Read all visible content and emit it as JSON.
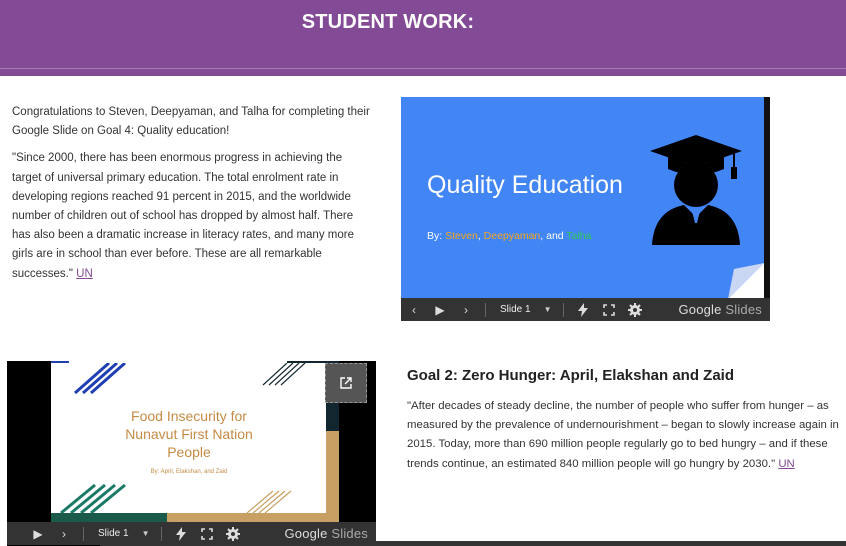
{
  "header": {
    "title": "STUDENT WORK:"
  },
  "intro": {
    "congrats": "Congratulations to Steven, Deepyaman, and Talha for completing their Google Slide on Goal 4: Quality education!",
    "quote": "\"Since 2000, there has been enormous progress in achieving the target of universal primary education. The total enrolment rate in developing regions reached 91 percent in 2015, and the worldwide number of children out of school has dropped by almost half. There has also been a dramatic increase in literacy rates, and many more girls are in school than ever before. These are all remarkable successes.\"",
    "link": "UN"
  },
  "slide1": {
    "title": "Quality Education",
    "by_prefix": "By: ",
    "author1": "Steven",
    "sep1": ", ",
    "author2": "Deepyaman",
    "sep2": ", and ",
    "author3": "Talha"
  },
  "player": {
    "prev": "‹",
    "play": "▶",
    "next": "›",
    "slide_label": "Slide 1",
    "logo_bold": "Google",
    "logo_light": " Slides"
  },
  "slide2": {
    "title_line1": "Food Insecurity for",
    "title_line2": "Nunavut First Nation",
    "title_line3": "People",
    "by": "By: April, Elakshan, and Zaid"
  },
  "goal2": {
    "title": "Goal 2: Zero Hunger: April, Elakshan and Zaid",
    "quote": "\"After decades of steady decline, the number of people who suffer from hunger – as measured by the prevalence of undernourishment – began to slowly increase again in 2015. Today, more than 690 million people regularly go to bed hungry – and if these trends continue, an estimated 840 million people will go hungry by 2030.\"",
    "link": "UN"
  },
  "colors": {
    "banner": "#834a95",
    "slide_blue": "#4285f4",
    "link": "#834a95"
  }
}
